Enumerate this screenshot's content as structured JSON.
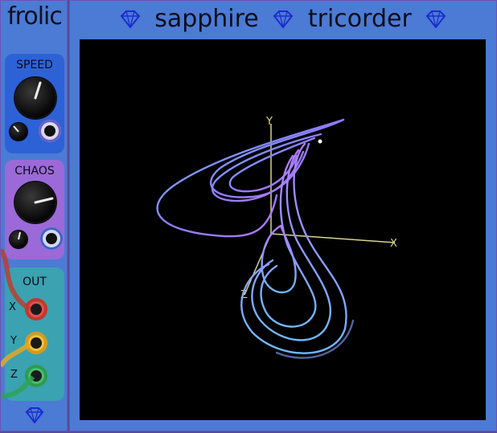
{
  "frolic": {
    "title": "frolic",
    "speed_label": "SPEED",
    "chaos_label": "CHAOS",
    "out_label": "OUT",
    "out_ports": [
      "X",
      "Y",
      "Z"
    ]
  },
  "tricorder": {
    "title_left": "sapphire",
    "title_right": "tricorder",
    "axes": [
      "Y",
      "X",
      "Z"
    ]
  },
  "colors": {
    "panel": "#4b7bd4",
    "speed_section": "#2d62d6",
    "chaos_section": "#9b6ad8",
    "out_section": "#3aa2b0",
    "cable_red": "#c0392b",
    "cable_yellow": "#e4a825",
    "cable_green": "#2ea355"
  },
  "icons": [
    "sapphire-gem-icon"
  ]
}
